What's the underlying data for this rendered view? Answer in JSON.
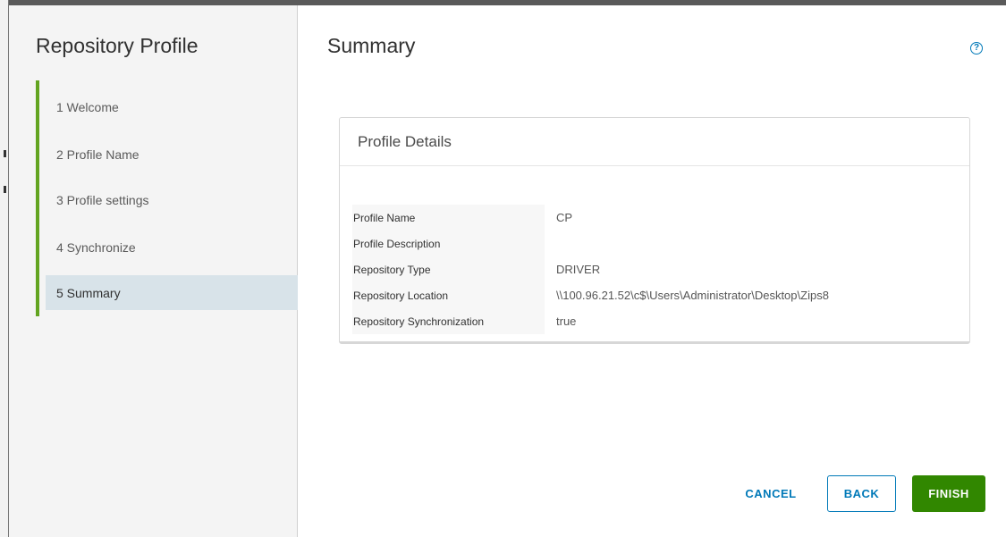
{
  "sidebar": {
    "title": "Repository Profile",
    "steps": [
      {
        "label": "1 Welcome"
      },
      {
        "label": "2 Profile Name"
      },
      {
        "label": "3 Profile settings"
      },
      {
        "label": "4 Synchronize"
      },
      {
        "label": "5 Summary"
      }
    ],
    "active_step": "5 Summary"
  },
  "main": {
    "title": "Summary",
    "help_icon": "question-circle-icon",
    "card": {
      "title": "Profile Details",
      "rows": [
        {
          "label": "Profile Name",
          "value": "CP"
        },
        {
          "label": "Profile Description",
          "value": ""
        },
        {
          "label": "Repository Type",
          "value": "DRIVER"
        },
        {
          "label": "Repository Location",
          "value": "\\\\100.96.21.52\\c$\\Users\\Administrator\\Desktop\\Zips8"
        },
        {
          "label": "Repository Synchronization",
          "value": "true"
        }
      ]
    }
  },
  "footer": {
    "cancel_label": "CANCEL",
    "back_label": "BACK",
    "finish_label": "FINISH"
  },
  "colors": {
    "accent": "#0079b8",
    "progress": "#62a420",
    "finish": "#318700",
    "active_step_bg": "#d8e3e9"
  }
}
